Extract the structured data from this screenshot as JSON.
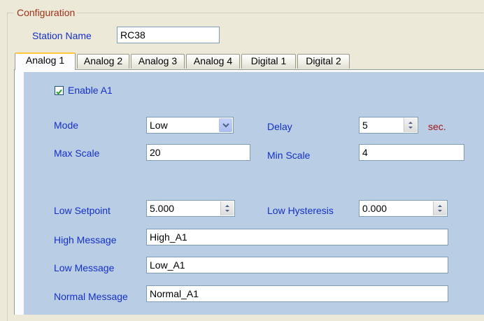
{
  "group": {
    "title": "Configuration"
  },
  "station": {
    "label": "Station Name",
    "value": "RC38"
  },
  "tabs": [
    {
      "label": "Analog 1"
    },
    {
      "label": "Analog 2"
    },
    {
      "label": "Analog 3"
    },
    {
      "label": "Analog 4"
    },
    {
      "label": "Digital 1"
    },
    {
      "label": "Digital 2"
    }
  ],
  "active_tab": "Analog 1",
  "enable": {
    "label": "Enable A1",
    "checked": true
  },
  "mode": {
    "label": "Mode",
    "value": "Low"
  },
  "delay": {
    "label": "Delay",
    "value": "5",
    "unit": "sec."
  },
  "max_scale": {
    "label": "Max Scale",
    "value": "20"
  },
  "min_scale": {
    "label": "Min Scale",
    "value": "4"
  },
  "low_setpoint": {
    "label": "Low Setpoint",
    "value": "5.000"
  },
  "low_hysteresis": {
    "label": "Low Hysteresis",
    "value": "0.000"
  },
  "high_message": {
    "label": "High Message",
    "value": "High_A1"
  },
  "low_message": {
    "label": "Low Message",
    "value": "Low_A1"
  },
  "normal_message": {
    "label": "Normal Message",
    "value": "Normal_A1"
  },
  "colors": {
    "panel": "#b9cde5",
    "label_blue": "#1530c8",
    "group_title": "#a03018",
    "unit": "#a01818",
    "active_tab_accent": "#ffc83c"
  }
}
